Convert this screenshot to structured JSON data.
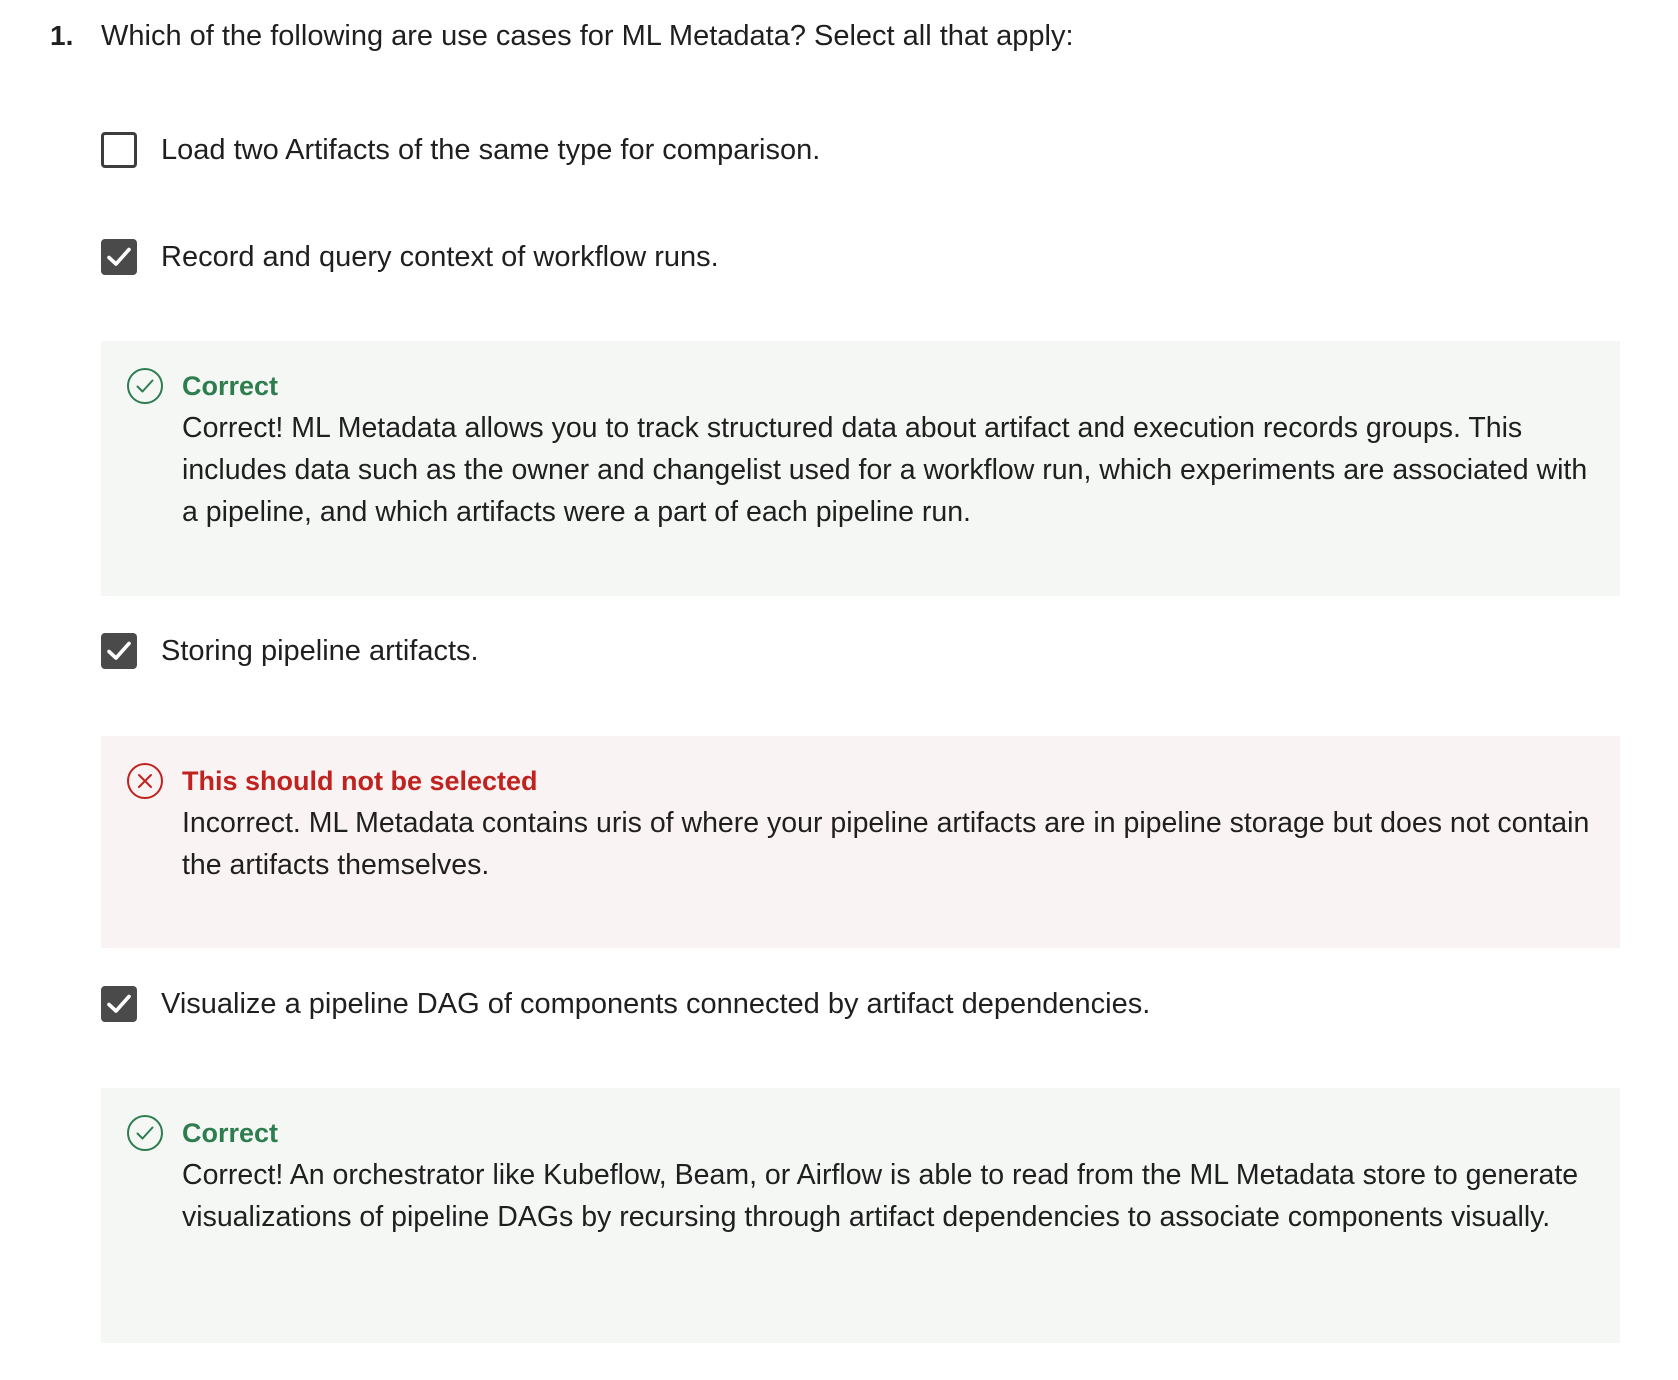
{
  "question": {
    "number": "1.",
    "text": "Which of the following are use cases for ML Metadata? Select all that apply:"
  },
  "options": [
    {
      "label": "Load two Artifacts of the same type for comparison.",
      "checked": false
    },
    {
      "label": "Record and query context of workflow runs.",
      "checked": true,
      "feedback": {
        "status": "correct",
        "title": "Correct",
        "text": "Correct! ML Metadata allows you to track structured data about artifact and execution records groups. This includes data such as the owner and changelist used for a workflow run, which experiments are associated with a pipeline, and which artifacts were a part of each pipeline run."
      }
    },
    {
      "label": "Storing pipeline artifacts.",
      "checked": true,
      "feedback": {
        "status": "incorrect",
        "title": "This should not be selected",
        "text": "Incorrect. ML Metadata contains uris of where your pipeline artifacts are in pipeline storage but does not contain the artifacts themselves."
      }
    },
    {
      "label": "Visualize a pipeline DAG of components connected by artifact dependencies.",
      "checked": true,
      "feedback": {
        "status": "correct",
        "title": "Correct",
        "text": "Correct! An orchestrator like Kubeflow, Beam, or Airflow is able to read from the ML Metadata store to generate visualizations of pipeline DAGs by recursing through artifact dependencies to associate components visually."
      }
    }
  ],
  "colors": {
    "correct": "#2e7d4f",
    "incorrect": "#c0231f",
    "correct_bg": "#f5f7f5",
    "incorrect_bg": "#faf3f3",
    "checkbox_checked": "#4a4a4a"
  },
  "icons": {
    "correct": "check-circle-icon",
    "incorrect": "x-circle-icon",
    "checkbox": "checkmark-icon"
  }
}
